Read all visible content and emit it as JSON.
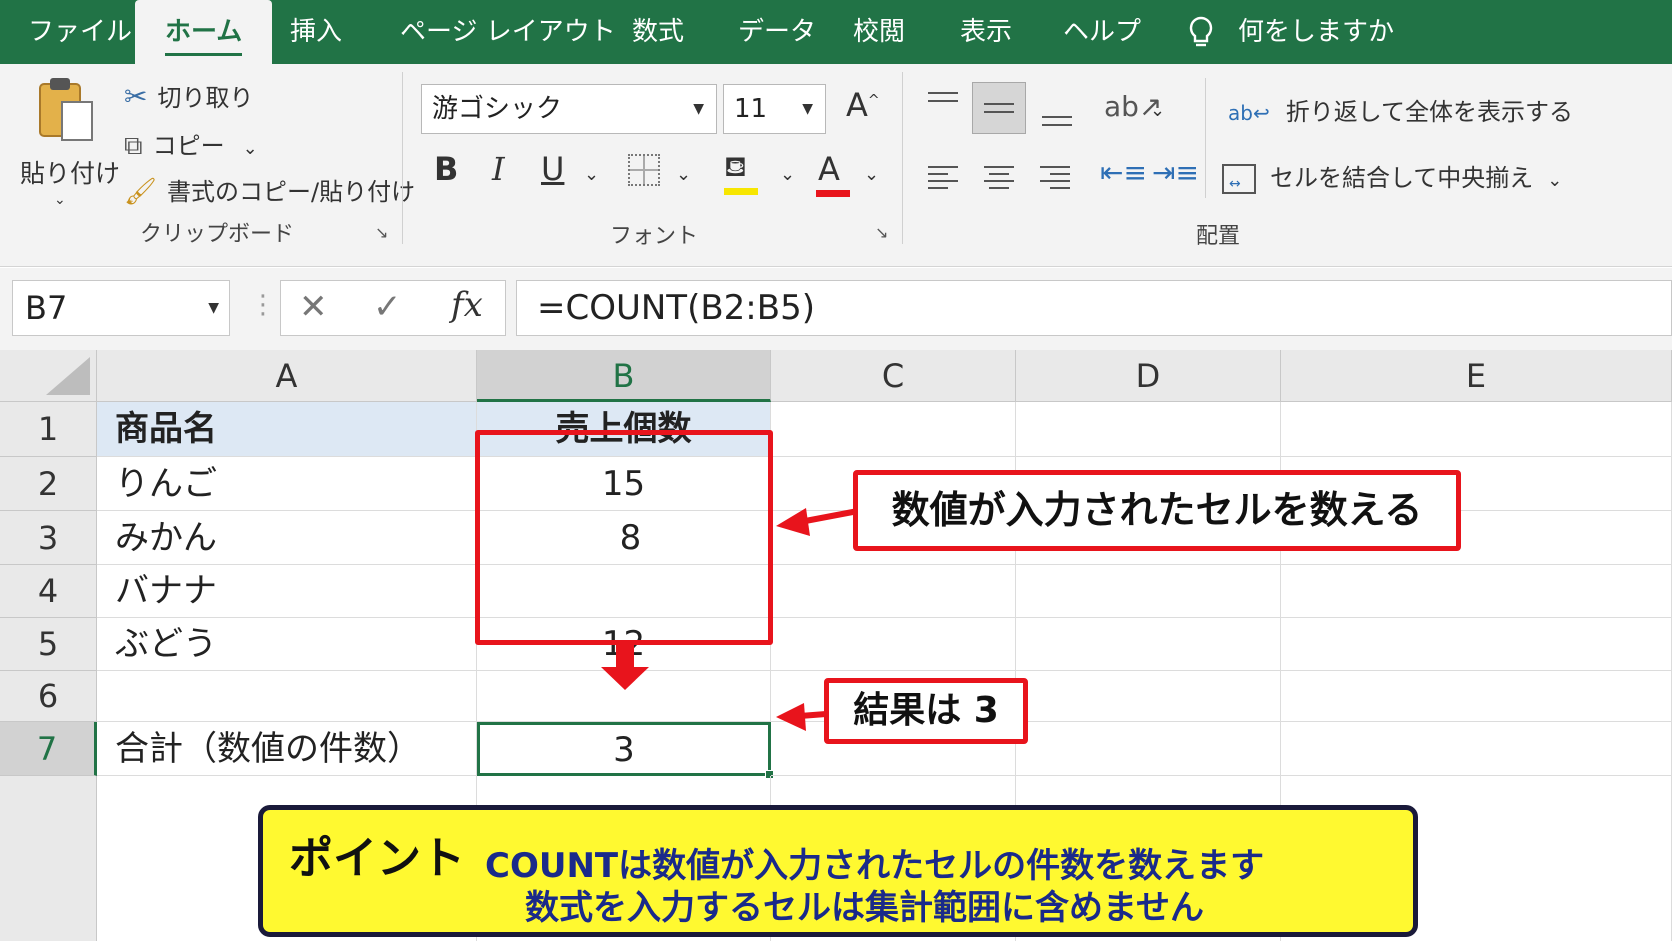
{
  "tabs": {
    "file": "ファイル",
    "home": "ホーム",
    "insert": "挿入",
    "page_layout": "ページ レイアウト",
    "formulas": "数式",
    "data": "データ",
    "review": "校閲",
    "view": "表示",
    "help": "ヘルプ",
    "tell_me": "何をしますか"
  },
  "clipboard": {
    "paste": "貼り付け",
    "cut": "切り取り",
    "copy": "コピー",
    "format_painter": "書式のコピー/貼り付け",
    "group_label": "クリップボード"
  },
  "font": {
    "font_name": "游ゴシック",
    "font_size": "11",
    "bold": "B",
    "italic": "I",
    "underline": "U",
    "font_color_glyph": "A",
    "group_label": "フォント",
    "highlight_color": "#f7e600",
    "font_color": "#e8141c"
  },
  "alignment": {
    "wrap_text": "折り返して全体を表示する",
    "merge_center": "セルを結合して中央揃え",
    "group_label": "配置"
  },
  "formula_bar": {
    "name_box": "B7",
    "fx": "fx",
    "formula": "=COUNT(B2:B5)"
  },
  "columns": [
    "A",
    "B",
    "C",
    "D",
    "E"
  ],
  "selected_column": "B",
  "rows": [
    "1",
    "2",
    "3",
    "4",
    "5",
    "6",
    "7"
  ],
  "selected_row": "7",
  "cells": {
    "a1": "商品名",
    "b1": "売上個数",
    "a2": "りんご",
    "b2": "15",
    "a3": "みかん",
    "b3": "8",
    "a4": "バナナ",
    "b4": "",
    "a5": "ぶどう",
    "b5": "12",
    "a7": "合計（数値の件数）",
    "b7": "3"
  },
  "callouts": {
    "range_note": "数値が入力されたセルを数える",
    "result_note": "結果は 3"
  },
  "point_box": {
    "title": "ポイント",
    "line1": "COUNTは数値が入力されたセルの件数を数えます",
    "line2": "数式を入力するセルは集計範囲に含めません"
  },
  "colors": {
    "excel_green": "#217346",
    "annotation_red": "#e8141c",
    "point_yellow": "#fff930",
    "header_blue": "#dde8f4"
  }
}
